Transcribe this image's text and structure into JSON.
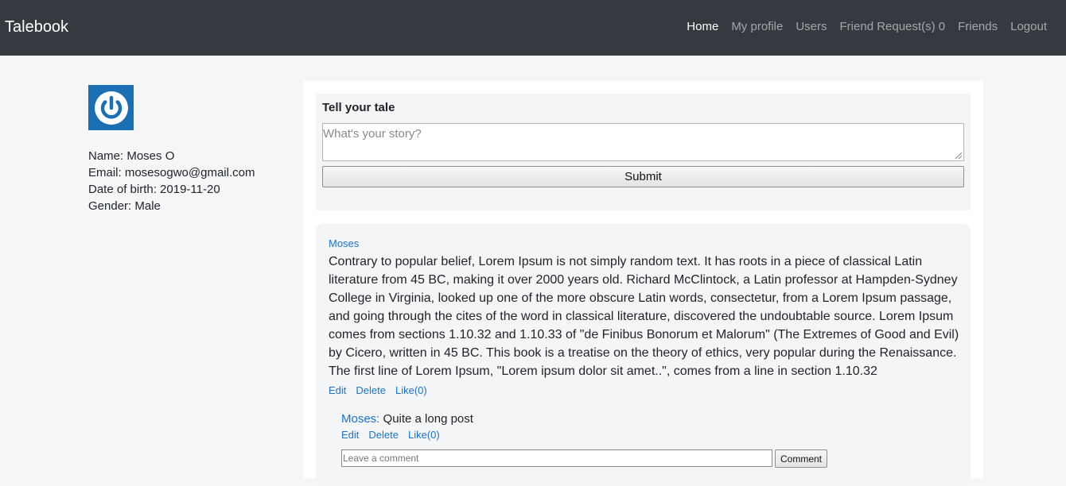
{
  "nav": {
    "brand": "Talebook",
    "links": [
      "Home",
      "My profile",
      "Users",
      "Friend Request(s) 0",
      "Friends",
      "Logout"
    ]
  },
  "profile": {
    "name": "Name: Moses O",
    "email": "Email: mosesogwo@gmail.com",
    "dob": "Date of birth: 2019-11-20",
    "gender": "Gender: Male"
  },
  "new_post": {
    "title": "Tell your tale",
    "placeholder": "What's your story?",
    "submit_label": "Submit"
  },
  "post": {
    "author": "Moses",
    "body": "Contrary to popular belief, Lorem Ipsum is not simply random text. It has roots in a piece of classical Latin literature from 45 BC, making it over 2000 years old. Richard McClintock, a Latin professor at Hampden-Sydney College in Virginia, looked up one of the more obscure Latin words, consectetur, from a Lorem Ipsum passage, and going through the cites of the word in classical literature, discovered the undoubtable source. Lorem Ipsum comes from sections 1.10.32 and 1.10.33 of \"de Finibus Bonorum et Malorum\" (The Extremes of Good and Evil) by Cicero, written in 45 BC. This book is a treatise on the theory of ethics, very popular during the Renaissance. The first line of Lorem Ipsum, \"Lorem ipsum dolor sit amet..\", comes from a line in section 1.10.32",
    "edit": "Edit",
    "delete": "Delete",
    "like": "Like(0)"
  },
  "comment": {
    "author": "Moses:",
    "text": " Quite a long post",
    "edit": "Edit",
    "delete": "Delete",
    "like": "Like(0)"
  },
  "comment_form": {
    "placeholder": "Leave a comment",
    "button_label": "Comment"
  },
  "colors": {
    "navbar": "#343a40",
    "link": "#1a73c9",
    "avatar": "#1b6fb5",
    "card": "#f4f5f7"
  },
  "icons": {
    "avatar": "power-icon"
  }
}
